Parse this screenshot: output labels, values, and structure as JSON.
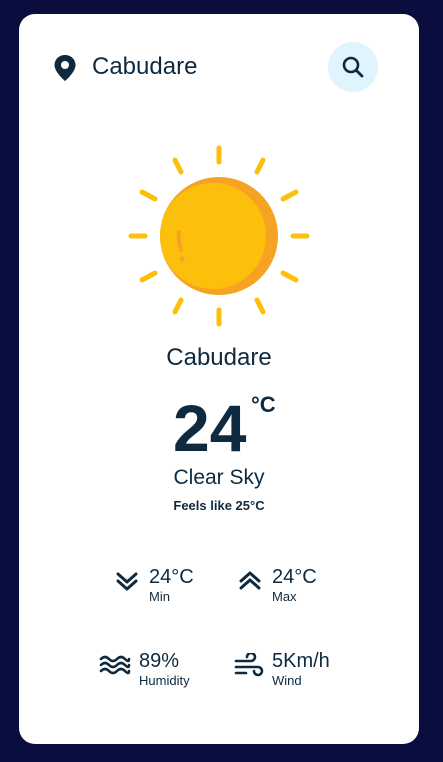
{
  "header": {
    "city": "Cabudare",
    "icons": {
      "location": "location-pin-icon",
      "search": "search-icon"
    }
  },
  "weather": {
    "icon": "sun-icon",
    "city": "Cabudare",
    "temperature": "24",
    "unit": "°C",
    "condition": "Clear Sky",
    "feels_like": "Feels like 25°C"
  },
  "stats": {
    "min": {
      "value": "24°C",
      "label": "Min",
      "icon": "double-chevron-down-icon"
    },
    "max": {
      "value": "24°C",
      "label": "Max",
      "icon": "double-chevron-up-icon"
    },
    "humidity": {
      "value": "89%",
      "label": "Humidity",
      "icon": "humidity-waves-icon"
    },
    "wind": {
      "value": "5Km/h",
      "label": "Wind",
      "icon": "wind-icon"
    }
  },
  "colors": {
    "background": "#0a0e3f",
    "card": "#ffffff",
    "text": "#0f2a3f",
    "search_bg": "#e0f4fd",
    "sun": "#fbbf0c",
    "sun_shade": "#f6a323"
  }
}
